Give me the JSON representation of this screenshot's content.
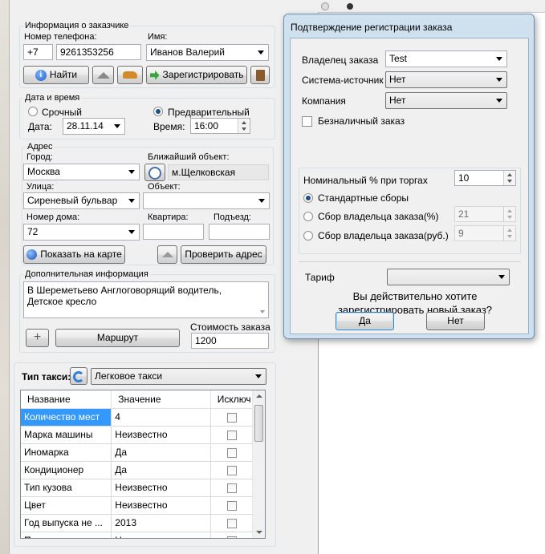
{
  "customer_group": {
    "legend": "Информация о заказчике",
    "phone_label": "Номер телефона:",
    "phone_code": "+7",
    "phone_number": "9261353256",
    "name_label": "Имя:",
    "name_value": "Иванов Валерий",
    "find_button": "Найти",
    "register_button": "Зарегистрировать"
  },
  "datetime_group": {
    "legend": "Дата и время",
    "urgent_label": "Срочный",
    "preliminary_label": "Предварительный",
    "date_label": "Дата:",
    "date_value": "28.11.14",
    "time_label": "Время:",
    "time_value": "16:00"
  },
  "address_group": {
    "legend": "Адрес",
    "city_label": "Город:",
    "city_value": "Москва",
    "nearest_label": "Ближайший объект:",
    "nearest_value": "м.Щелковская",
    "street_label": "Улица:",
    "street_value": "Сиреневый бульвар",
    "object_label": "Объект:",
    "object_value": "",
    "house_label": "Номер дома:",
    "house_value": "72",
    "apartment_label": "Квартира:",
    "entrance_label": "Подъезд:",
    "show_map_button": "Показать на карте",
    "check_address_button": "Проверить адрес"
  },
  "extra_group": {
    "legend": "Дополнительная информация",
    "notes": "В Шереметьево Англоговорящий водитель, Детское кресло",
    "route_button": "Маршрут",
    "cost_label": "Стоимость заказа",
    "cost_value": "1200"
  },
  "taxi_type": {
    "label": "Тип такси:",
    "value": "Легковое такси"
  },
  "grid": {
    "columns": [
      "Название",
      "Значение",
      "Исключ"
    ],
    "rows": [
      {
        "name": "Количество мест",
        "value": "4"
      },
      {
        "name": "Марка машины",
        "value": "Неизвестно"
      },
      {
        "name": "Иномарка",
        "value": "Да"
      },
      {
        "name": "Кондиционер",
        "value": "Да"
      },
      {
        "name": "Тип кузова",
        "value": "Неизвестно"
      },
      {
        "name": "Цвет",
        "value": "Неизвестно"
      },
      {
        "name": "Год выпуска не ...",
        "value": "2013"
      },
      {
        "name": "Пол. кресло для ...",
        "value": "Неизвестно"
      }
    ]
  },
  "dialog": {
    "title": "Подтверждение регистрации заказа",
    "owner_label": "Владелец заказа",
    "owner_value": "Test",
    "source_label": "Система-источник",
    "source_value": "Нет",
    "company_label": "Компания",
    "company_value": "Нет",
    "cashless_label": "Безналичный заказ",
    "nominal_label": "Номинальный % при торгах",
    "nominal_value": "10",
    "standard_fees_label": "Стандартные сборы",
    "owner_fee_pct_label": "Сбор владельца заказа(%)",
    "owner_fee_pct_value": "21",
    "owner_fee_rub_label": "Сбор владельца заказа(руб.)",
    "owner_fee_rub_value": "9",
    "tariff_label": "Тариф",
    "tariff_value": "",
    "question": "Вы действительно хотите зарегистрировать новый заказ?",
    "yes_button": "Да",
    "no_button": "Нет"
  },
  "colors": {
    "selection": "#3399ff",
    "dialog_frame": "#cfe0ef",
    "group_border": "#d5dfe5"
  }
}
